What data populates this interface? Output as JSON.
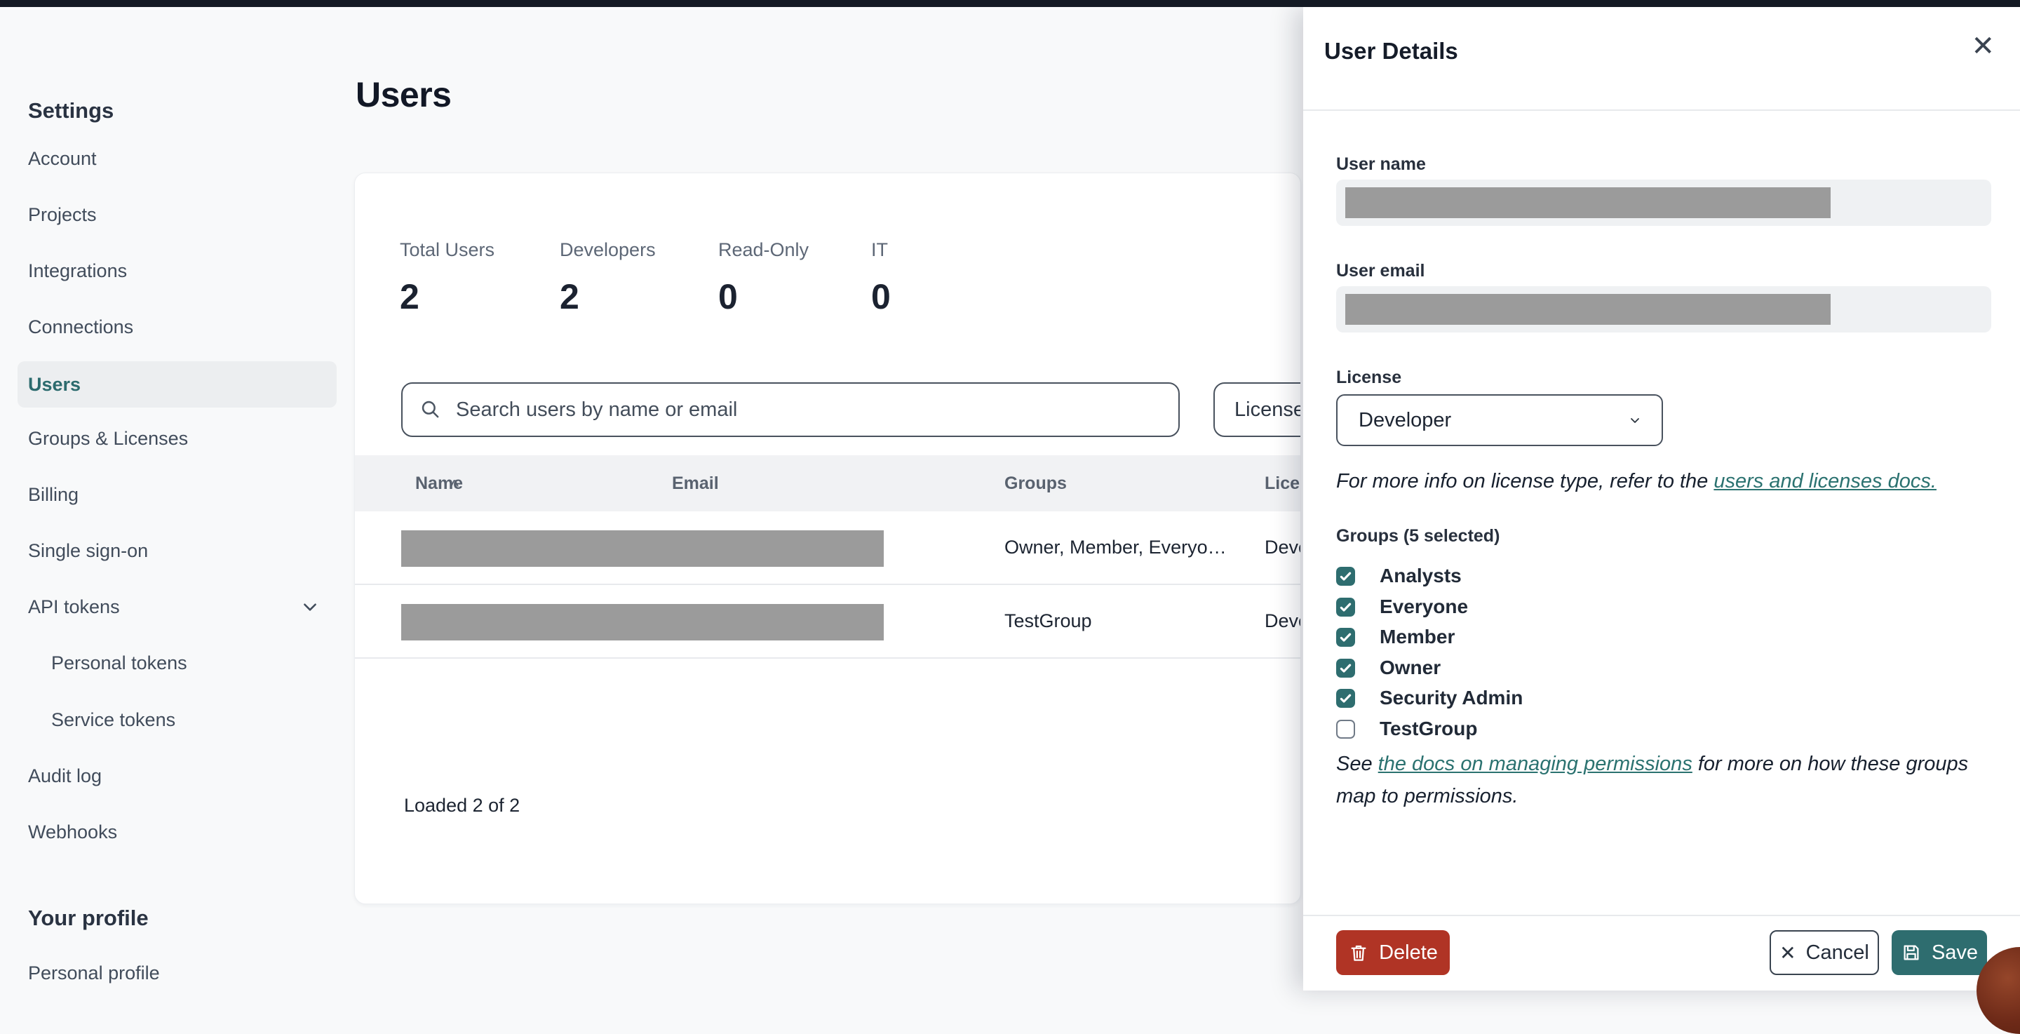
{
  "colors": {
    "topbar": "#141a24",
    "accent_teal": "#2e6d6f",
    "link_teal": "#2b7270",
    "selected_item_text": "#2c6b6e",
    "delete_red": "#b03425",
    "redaction_gray": "#9b9b9b",
    "page_bg": "#f8f9fa"
  },
  "sidebar": {
    "settings_heading": "Settings",
    "items": [
      {
        "label": "Account"
      },
      {
        "label": "Projects"
      },
      {
        "label": "Integrations"
      },
      {
        "label": "Connections"
      },
      {
        "label": "Users",
        "selected": true
      },
      {
        "label": "Groups & Licenses"
      },
      {
        "label": "Billing"
      },
      {
        "label": "Single sign-on"
      },
      {
        "label": "API tokens",
        "expandable": true
      },
      {
        "label": "Personal tokens",
        "indent": true
      },
      {
        "label": "Service tokens",
        "indent": true
      },
      {
        "label": "Audit log"
      },
      {
        "label": "Webhooks"
      }
    ],
    "profile_heading": "Your profile",
    "profile_items": [
      {
        "label": "Personal profile"
      }
    ]
  },
  "main": {
    "title": "Users",
    "stats": [
      {
        "label": "Total Users",
        "value": "2"
      },
      {
        "label": "Developers",
        "value": "2"
      },
      {
        "label": "Read-Only",
        "value": "0"
      },
      {
        "label": "IT",
        "value": "0"
      }
    ],
    "search_placeholder": "Search users by name or email",
    "license_filter_label": "License",
    "table": {
      "columns": {
        "name": "Name",
        "email": "Email",
        "groups": "Groups",
        "license": "License"
      },
      "sort_indicator": "^",
      "rows": [
        {
          "name": "",
          "email": "",
          "groups": "Owner, Member, Everyo…",
          "license": "Developer",
          "redacted": true
        },
        {
          "name": "",
          "email": "",
          "groups": "TestGroup",
          "license": "Developer",
          "redacted": true
        }
      ]
    },
    "loaded_text": "Loaded 2 of 2"
  },
  "panel": {
    "title": "User Details",
    "close_glyph": "✕",
    "user_name_label": "User name",
    "user_name_value": "",
    "user_email_label": "User email",
    "user_email_value": "",
    "license_label": "License",
    "license_value": "Developer",
    "license_note": {
      "prefix": "For more info on license type, refer to the ",
      "link": "users and licenses docs."
    },
    "groups_label": "Groups (5 selected)",
    "groups": [
      {
        "name": "Analysts",
        "checked": true
      },
      {
        "name": "Everyone",
        "checked": true
      },
      {
        "name": "Member",
        "checked": true
      },
      {
        "name": "Owner",
        "checked": true
      },
      {
        "name": "Security Admin",
        "checked": true
      },
      {
        "name": "TestGroup",
        "checked": false
      }
    ],
    "permissions_note": {
      "prefix": "See ",
      "link": "the docs on managing permissions",
      "suffix": " for more on how these groups map to permissions."
    },
    "footer": {
      "delete_label": "Delete",
      "cancel_label": "Cancel",
      "cancel_icon_glyph": "✕",
      "save_label": "Save"
    }
  }
}
